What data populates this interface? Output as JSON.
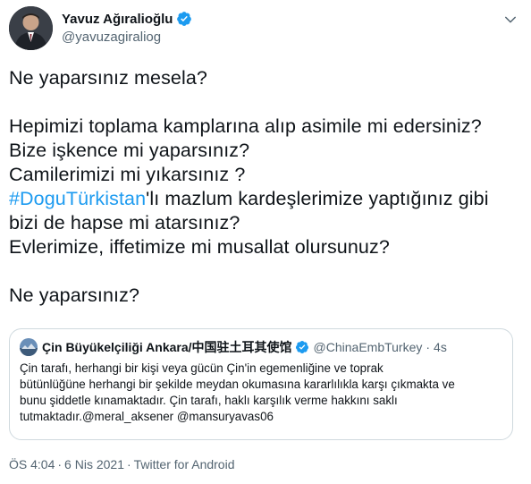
{
  "author": {
    "display_name": "Yavuz Ağıralioğlu",
    "handle": "@yavuzagiraliog",
    "avatar_icon": "profile-photo",
    "verified_icon": "verified-badge-icon"
  },
  "body": {
    "line1": "Ne yaparsınız mesela?",
    "line2": "Hepimizi toplama kamplarına alıp asimile mi edersiniz?",
    "line3": "Bize işkence mi yaparsınız?",
    "line4": "Camilerimizi mi yıkarsınız ?",
    "line5_hashtag": "#DoguTürkistan",
    "line5_rest": "'lı mazlum kardeşlerimize yaptığınız gibi",
    "line6": "bizi de hapse mi atarsınız?",
    "line7": "Evlerimize, iffetimize mi musallat olursunuz?",
    "line8": "Ne yaparsınız?"
  },
  "quote": {
    "display_name": "Çin Büyükelçiliği Ankara/中国驻土耳其使馆",
    "handle": "@ChinaEmbTurkey",
    "dot": "·",
    "time": "4s",
    "lines": [
      "Çin tarafı, herhangi bir kişi veya gücün Çin'in egemenliğine ve toprak",
      "bütünlüğüne herhangi bir şekilde meydan okumasına kararlılıkla karşı çıkmakta ve",
      "bunu şiddetle kınamaktadır. Çin tarafı, haklı karşılık verme hakkını saklı",
      "tutmaktadır.@meral_aksener @mansuryavas06"
    ]
  },
  "meta": {
    "time": "ÖS 4:04",
    "dot1": "·",
    "date": "6 Nis 2021",
    "dot2": "·",
    "source": "Twitter for Android"
  },
  "colors": {
    "text": "#0f1419",
    "secondary": "#536471",
    "accent": "#1d9bf0",
    "border": "#cfd9de"
  }
}
